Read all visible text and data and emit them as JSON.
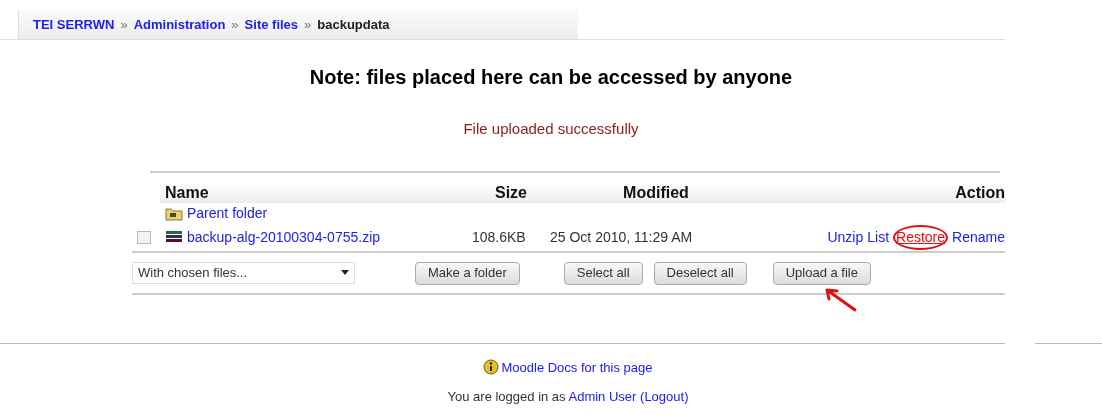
{
  "breadcrumb": [
    {
      "label": "TEI SERRWN",
      "link": true
    },
    {
      "label": "Administration",
      "link": true
    },
    {
      "label": "Site files",
      "link": true
    },
    {
      "label": "backupdata",
      "link": false
    }
  ],
  "breadcrumb_separator": "»",
  "title": "Note: files placed here can be accessed by anyone",
  "message": "File uploaded successfully",
  "table": {
    "columns": [
      "Name",
      "Size",
      "Modified",
      "Action"
    ],
    "rows": [
      {
        "kind": "parent",
        "name": "Parent folder"
      },
      {
        "kind": "file",
        "checked": false,
        "name": "backup-alg-20100304-0755.zip",
        "size": "108.6KB",
        "modified": "25 Oct 2010, 11:29 AM",
        "actions": [
          {
            "label": "Unzip",
            "highlighted": false
          },
          {
            "label": "List",
            "highlighted": false
          },
          {
            "label": "Restore",
            "highlighted": true
          },
          {
            "label": "Rename",
            "highlighted": false
          }
        ]
      }
    ]
  },
  "bulk_select": {
    "value": "With chosen files..."
  },
  "buttons": [
    {
      "label": "Make a folder",
      "highlighted": false
    },
    {
      "label": "Select all",
      "highlighted": false
    },
    {
      "label": "Deselect all",
      "highlighted": false
    },
    {
      "label": "Upload a file",
      "highlighted": true
    }
  ],
  "footer": {
    "docs_link": "Moodle Docs for this page",
    "login_prefix": "You are logged in as",
    "user": "Admin User",
    "logout": "(Logout)"
  }
}
